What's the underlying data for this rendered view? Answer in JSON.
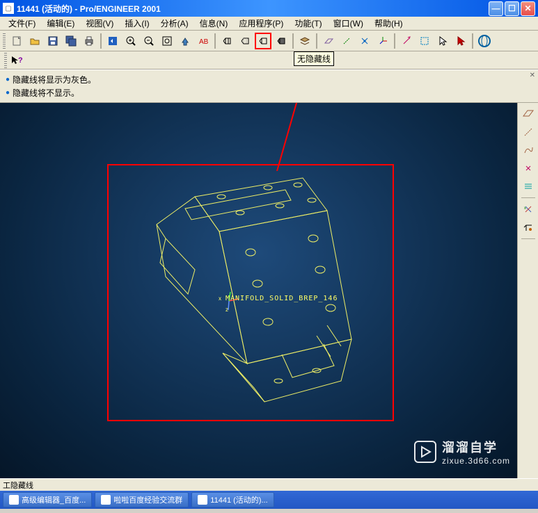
{
  "titlebar": {
    "title": "11441 (活动的) - Pro/ENGINEER 2001"
  },
  "menu": {
    "file": "文件(F)",
    "edit": "编辑(E)",
    "view": "视图(V)",
    "insert": "插入(I)",
    "analysis": "分析(A)",
    "info": "信息(N)",
    "application": "应用程序(P)",
    "function": "功能(T)",
    "window": "窗口(W)",
    "help": "帮助(H)"
  },
  "tooltip": "无隐藏线",
  "messages": {
    "line1": "隐藏线将显示为灰色。",
    "line2": "隐藏线将不显示。"
  },
  "model": {
    "label": "MANIFOLD_SOLID_BREP_146"
  },
  "watermark": {
    "brand": "溜溜自学",
    "url": "zixue.3d66.com"
  },
  "status": "工隐藏线",
  "taskbar": {
    "item1": "高级编辑器_百度...",
    "item2": "啦啦百度经验交流群",
    "item3": "11441 (活动的)..."
  }
}
